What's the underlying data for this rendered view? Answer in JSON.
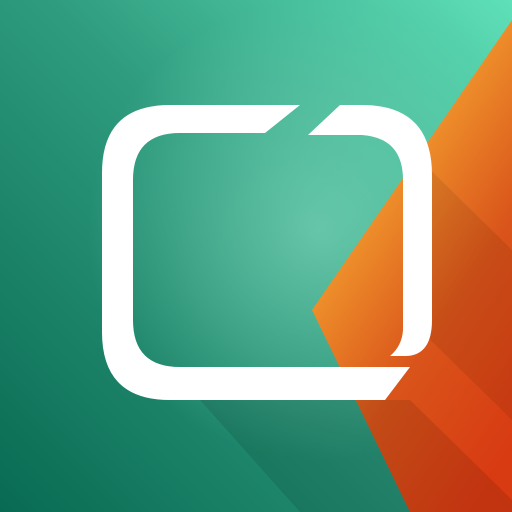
{
  "icon": {
    "semantic": "rounded-square-frame-logo-icon",
    "colors": {
      "green_dark": "#086a52",
      "green_mid": "#2f9c7f",
      "green_light": "#5fe0b8",
      "orange": "#f29a2e",
      "orange_dark": "#d9541a",
      "red": "#d83a12",
      "white": "#ffffff"
    }
  }
}
